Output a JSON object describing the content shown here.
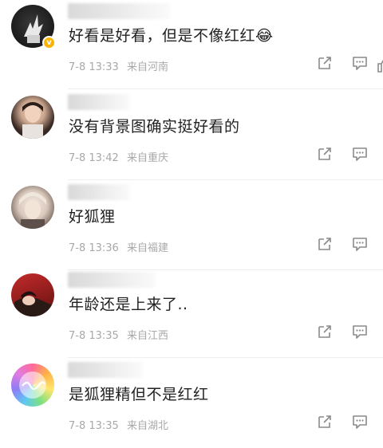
{
  "comments": [
    {
      "text": "好看是好看，但是不像红红😂",
      "time": "7-8 13:33",
      "location": "来自河南",
      "verified": true,
      "avatar_icon": "hand-gesture-avatar"
    },
    {
      "text": "没有背景图确实挺好看的",
      "time": "7-8 13:42",
      "location": "来自重庆",
      "verified": false,
      "avatar_icon": "person-photo-avatar"
    },
    {
      "text": "好狐狸",
      "time": "7-8 13:36",
      "location": "来自福建",
      "verified": false,
      "avatar_icon": "person-photo-avatar"
    },
    {
      "text": "年龄还是上来了..",
      "time": "7-8 13:35",
      "location": "来自江西",
      "verified": false,
      "avatar_icon": "person-lying-avatar"
    },
    {
      "text": "是狐狸精但不是红红",
      "time": "7-8 13:35",
      "location": "来自湖北",
      "verified": false,
      "avatar_icon": "rainbow-calligraphy-avatar"
    }
  ],
  "icons": {
    "share": "share-icon",
    "comment": "comment-icon",
    "like": "like-icon"
  },
  "colors": {
    "text": "#222222",
    "meta": "#a8a8a8",
    "badge": "#f8b400",
    "icon": "#8a8a8a"
  }
}
